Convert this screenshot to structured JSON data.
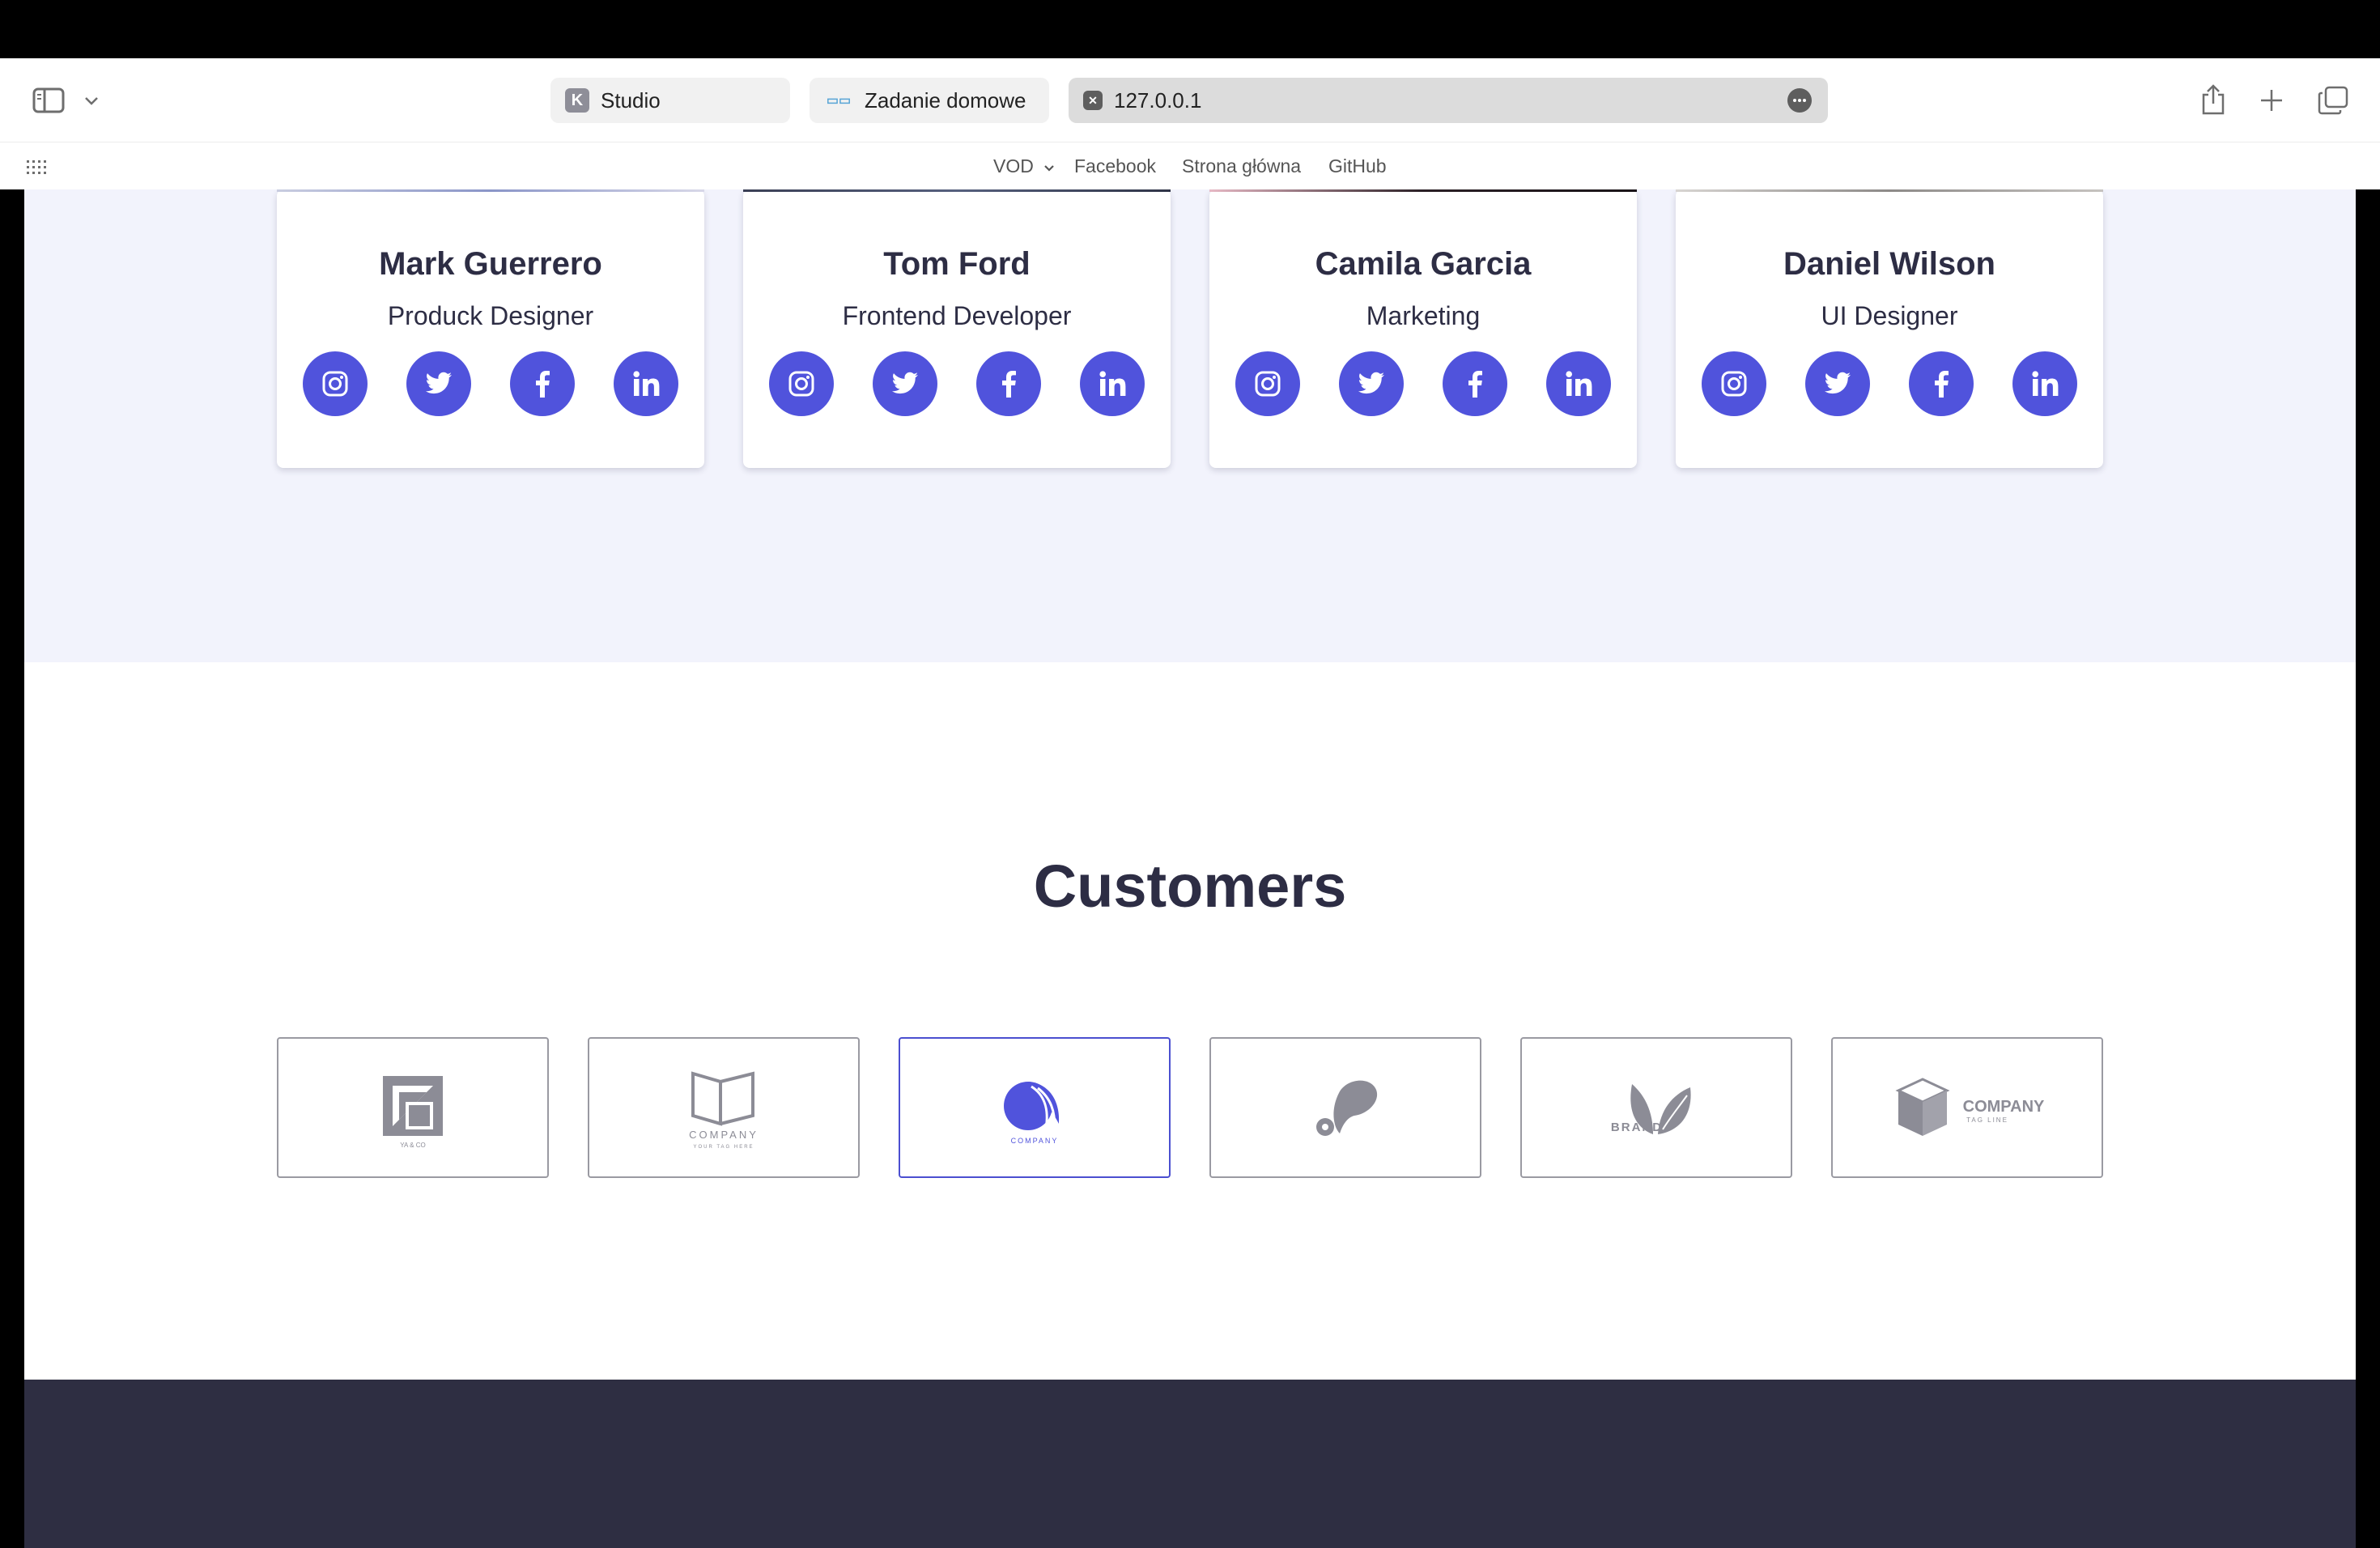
{
  "browser": {
    "tabs": [
      {
        "label": "Studio",
        "favicon": "K"
      },
      {
        "label": "Zadanie domowe",
        "favicon": "▭▭"
      },
      {
        "label": "127.0.0.1",
        "favicon": "✕"
      }
    ],
    "favorites": {
      "vod": "VOD",
      "facebook": "Facebook",
      "home": "Strona główna",
      "github": "GitHub"
    }
  },
  "team": [
    {
      "name": "Mark Guerrero",
      "role": "Produck Designer"
    },
    {
      "name": "Tom Ford",
      "role": "Frontend Developer"
    },
    {
      "name": "Camila Garcia",
      "role": "Marketing"
    },
    {
      "name": "Daniel Wilson",
      "role": "UI Designer"
    }
  ],
  "customers": {
    "title": "Customers",
    "logos": [
      {
        "text": "YA & CO"
      },
      {
        "text": "COMPANY",
        "sub": "YOUR TAG HERE"
      },
      {
        "text": "COMPANY"
      },
      {
        "text": ""
      },
      {
        "text": "BRAND"
      },
      {
        "text": "COMPANY",
        "sub": "TAG LINE"
      }
    ]
  },
  "colors": {
    "accent": "#5053dc",
    "heading": "#2d2d44",
    "section_bg": "#f2f3fc",
    "footer_bg": "#2e2e42",
    "logo_gray": "#8c8c96"
  }
}
